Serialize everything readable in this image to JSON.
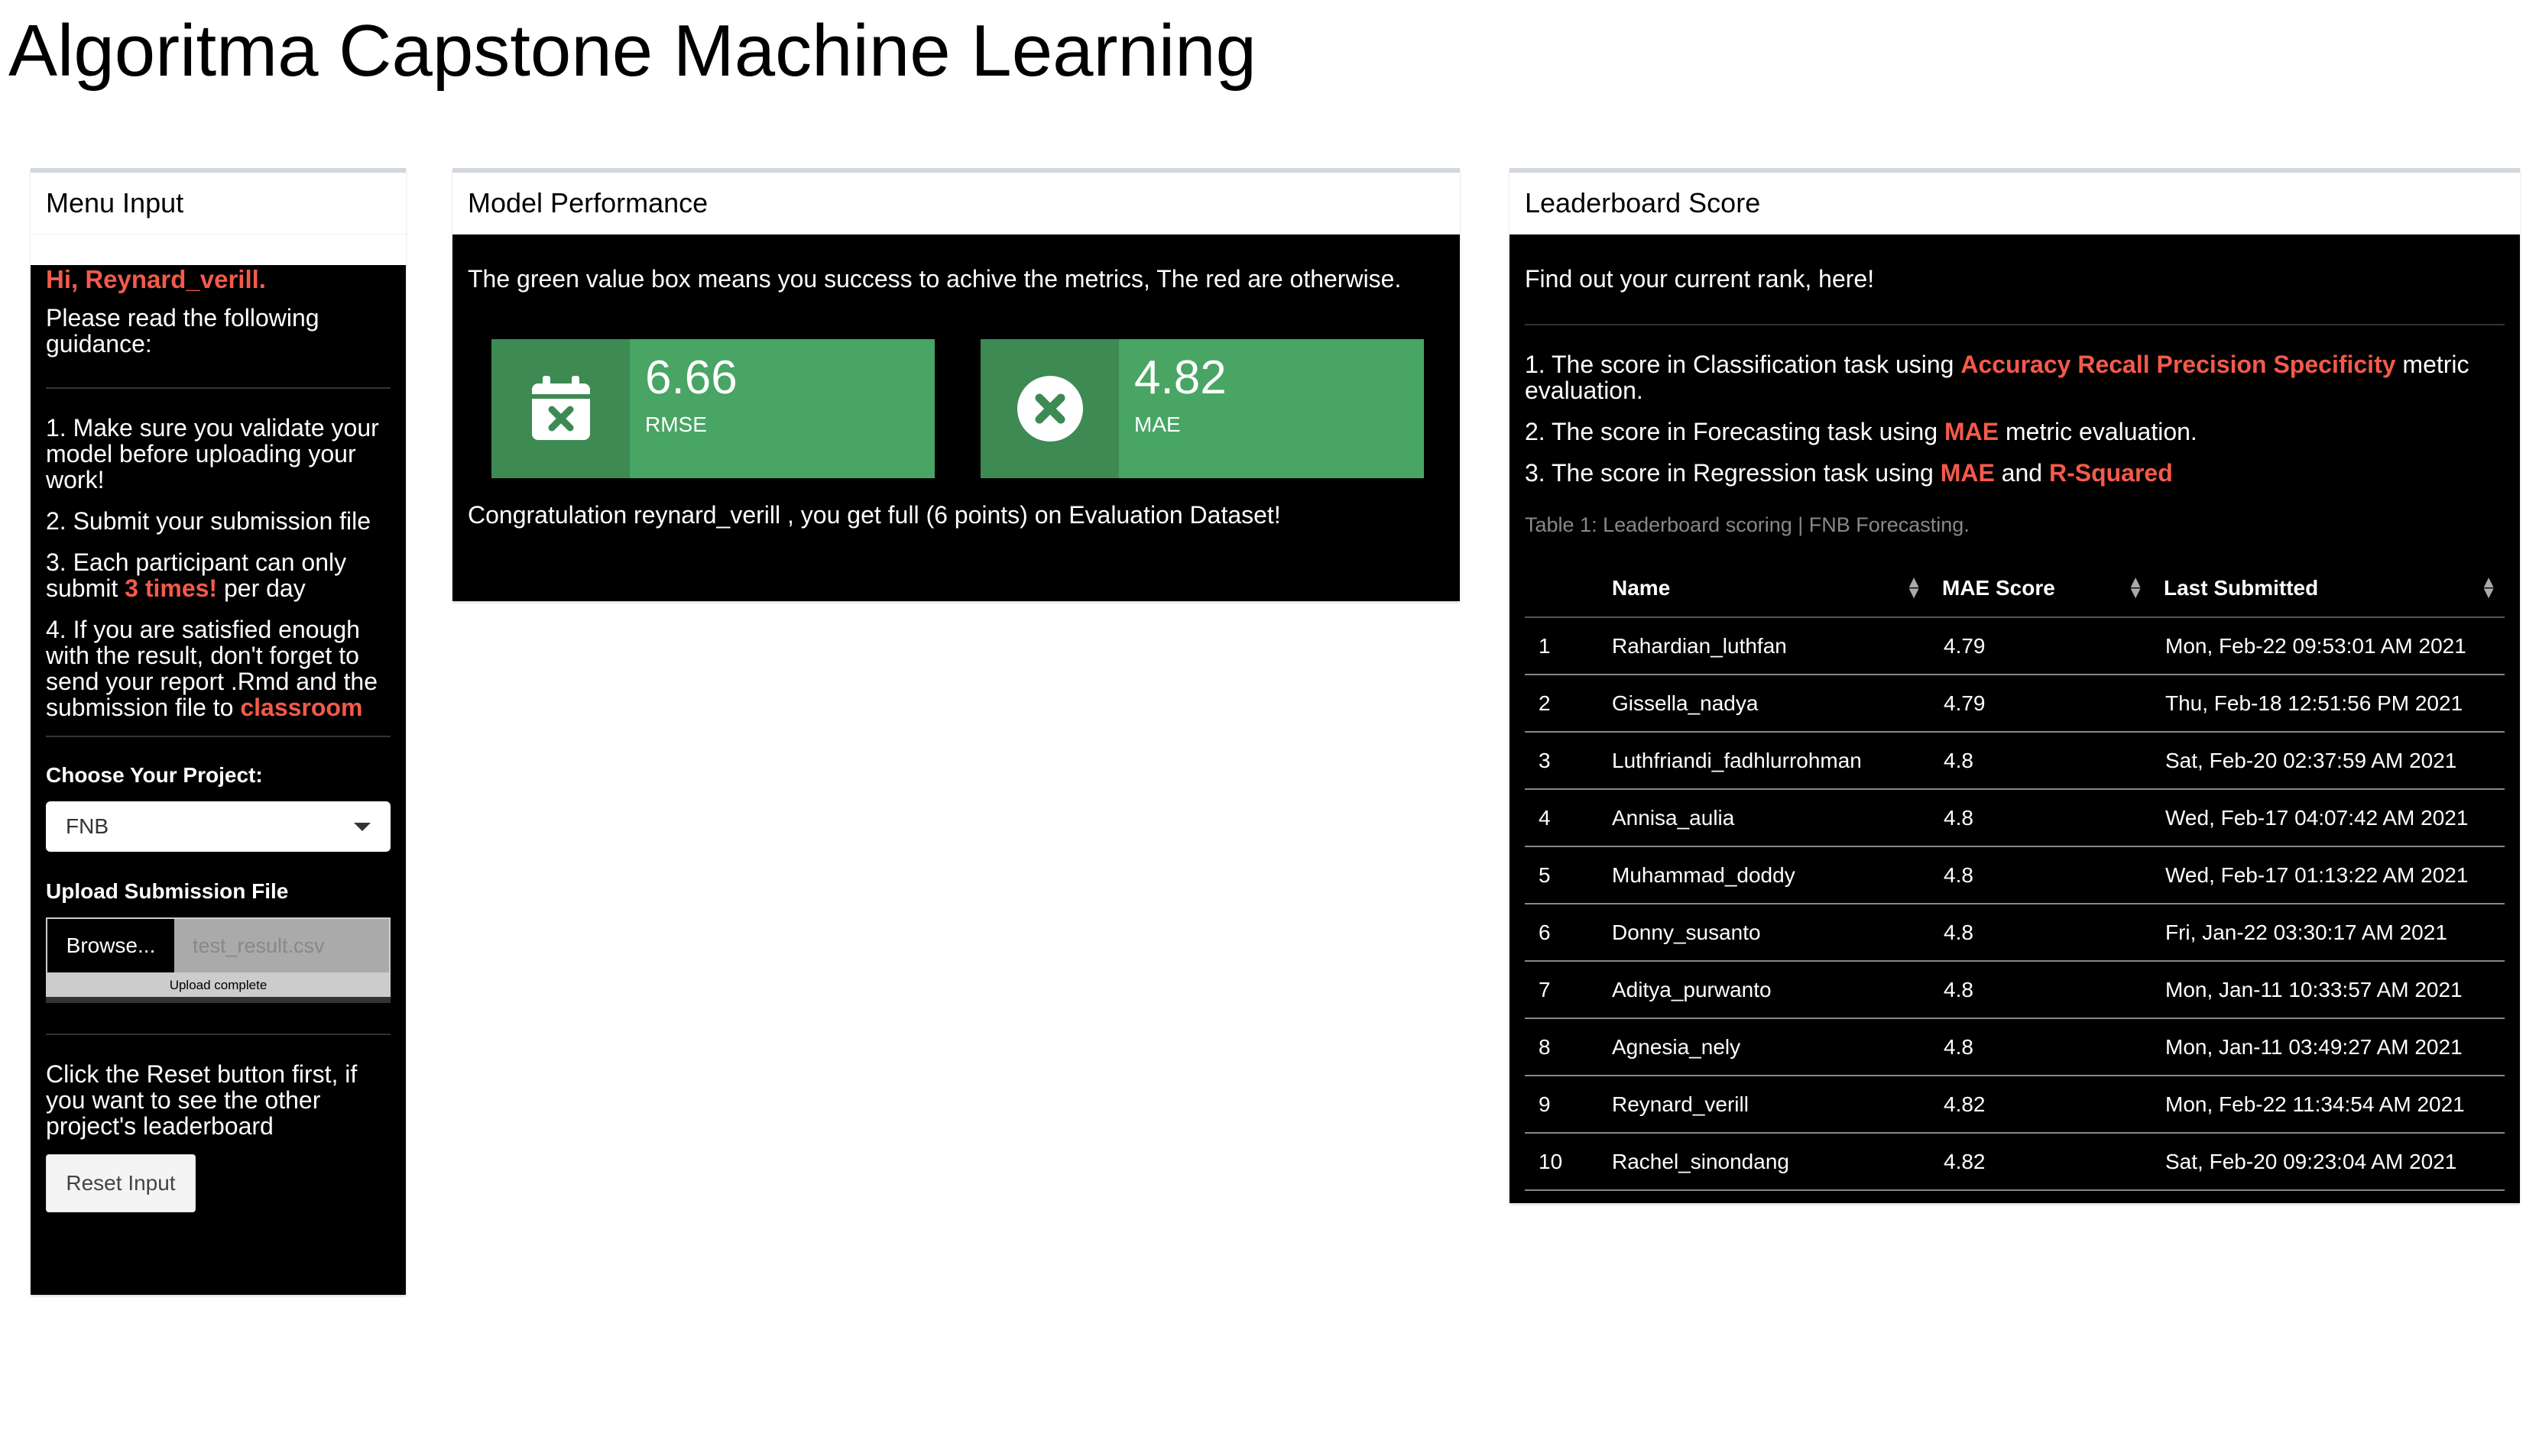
{
  "app_title": "Algoritma Capstone Machine Learning",
  "menu": {
    "header": "Menu Input",
    "greeting": "Hi, Reynard_verill.",
    "intro": "Please read the following guidance:",
    "step1": "1. Make sure you validate your model before uploading your work!",
    "step2": "2. Submit your submission file",
    "step3_prefix": "3. Each participant can only submit ",
    "step3_highlight": "3 times!",
    "step3_suffix": " per day",
    "step4_prefix": "4. If you are satisfied enough with the result, don't forget to send your report .Rmd and the submission file to ",
    "step4_highlight": "classroom",
    "project_label": "Choose Your Project:",
    "project_value": "FNB",
    "upload_label": "Upload Submission File",
    "browse_label": "Browse...",
    "file_name": "test_result.csv",
    "upload_status": "Upload complete",
    "reset_note": "Click the Reset button first, if you want to see the other project's leaderboard",
    "reset_label": "Reset Input"
  },
  "model": {
    "header": "Model Performance",
    "description": "The green value box means you success to achive the metrics, The red are otherwise.",
    "boxes": [
      {
        "value": "6.66",
        "label": "RMSE",
        "icon": "calendar-x-icon"
      },
      {
        "value": "4.82",
        "label": "MAE",
        "icon": "times-circle-icon"
      }
    ],
    "congrats": "Congratulation reynard_verill , you get full (6 points) on Evaluation Dataset!"
  },
  "board": {
    "header": "Leaderboard Score",
    "find": "Find out your current rank, here!",
    "line1_prefix": "1. The score in Classification task using ",
    "line1_highlight": "Accuracy Recall Precision Specificity",
    "line1_suffix": " metric evaluation.",
    "line2_prefix": "2. The score in Forecasting task using ",
    "line2_highlight": "MAE",
    "line2_suffix": " metric evaluation.",
    "line3_prefix": "3. The score in Regression task using ",
    "line3_highlight1": "MAE",
    "line3_mid": " and ",
    "line3_highlight2": "R-Squared",
    "caption": "Table 1: Leaderboard scoring | FNB Forecasting.",
    "columns": [
      "",
      "Name",
      "MAE Score",
      "Last Submitted"
    ],
    "rows": [
      [
        "1",
        "Rahardian_luthfan",
        "4.79",
        "Mon, Feb-22 09:53:01 AM 2021"
      ],
      [
        "2",
        "Gissella_nadya",
        "4.79",
        "Thu, Feb-18 12:51:56 PM 2021"
      ],
      [
        "3",
        "Luthfriandi_fadhlurrohman",
        "4.8",
        "Sat, Feb-20 02:37:59 AM 2021"
      ],
      [
        "4",
        "Annisa_aulia",
        "4.8",
        "Wed, Feb-17 04:07:42 AM 2021"
      ],
      [
        "5",
        "Muhammad_doddy",
        "4.8",
        "Wed, Feb-17 01:13:22 AM 2021"
      ],
      [
        "6",
        "Donny_susanto",
        "4.8",
        "Fri, Jan-22 03:30:17 AM 2021"
      ],
      [
        "7",
        "Aditya_purwanto",
        "4.8",
        "Mon, Jan-11 10:33:57 AM 2021"
      ],
      [
        "8",
        "Agnesia_nely",
        "4.8",
        "Mon, Jan-11 03:49:27 AM 2021"
      ],
      [
        "9",
        "Reynard_verill",
        "4.82",
        "Mon, Feb-22 11:34:54 AM 2021"
      ],
      [
        "10",
        "Rachel_sinondang",
        "4.82",
        "Sat, Feb-20 09:23:04 AM 2021"
      ]
    ]
  },
  "colors": {
    "accent_red": "#f35a4a",
    "box_green": "#48a564",
    "box_green_dark": "#3d8a53"
  }
}
